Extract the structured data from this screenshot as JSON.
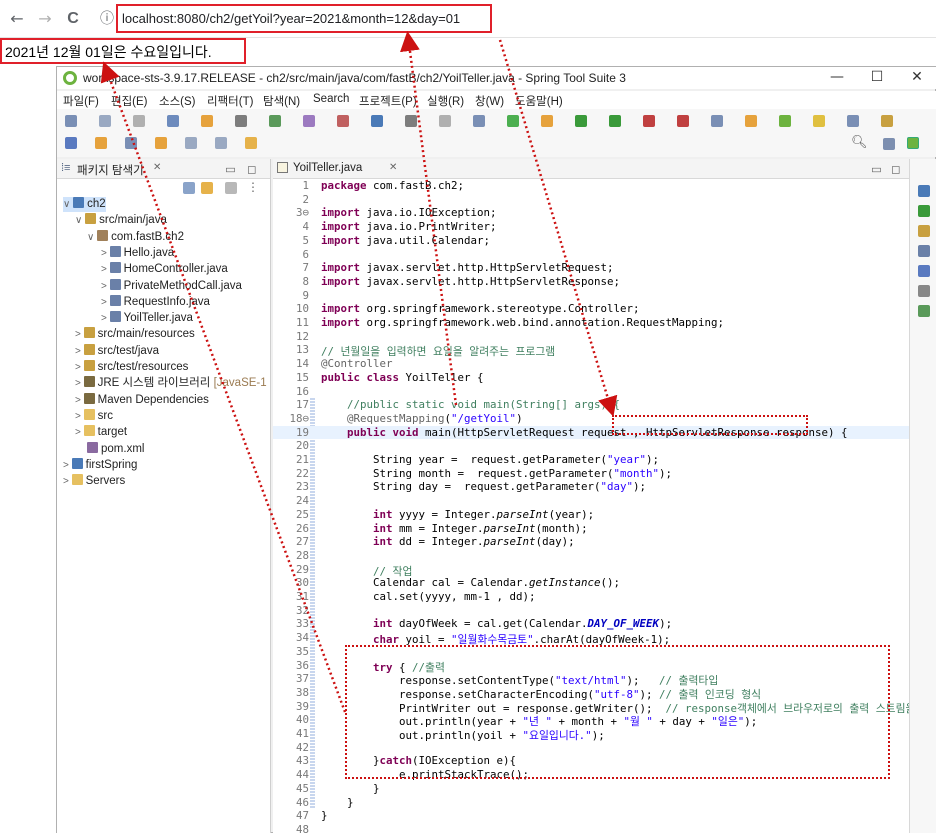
{
  "browser": {
    "back": "←",
    "forward": "→",
    "reload": "C",
    "info": "ⓘ",
    "url_host": "localhost",
    "url_rest": ":8080/ch2/getYoil?year=2021&month=12&day=01"
  },
  "page_output": "2021년 12월 01일은 수요일입니다.",
  "window": {
    "title": "workspace-sts-3.9.17.RELEASE - ch2/src/main/java/com/fastB/ch2/YoilTeller.java - Spring Tool Suite 3",
    "minimize": "—",
    "maximize": "☐",
    "close": "✕"
  },
  "menu": [
    "파일(F)",
    "편집(E)",
    "소스(S)",
    "리팩터(T)",
    "탐색(N)",
    "Search",
    "프로젝트(P)",
    "실행(R)",
    "창(W)",
    "도움말(H)"
  ],
  "explorer": {
    "title": "패키지 탐색기",
    "close": "✕",
    "items": [
      {
        "label": "ch2",
        "icon": "project-icon"
      },
      {
        "label": "src/main/java",
        "icon": "source-folder-icon"
      },
      {
        "label": "com.fastB.ch2",
        "icon": "package-icon"
      },
      {
        "label": "Hello.java",
        "icon": "java-file-icon"
      },
      {
        "label": "HomeController.java",
        "icon": "java-file-icon"
      },
      {
        "label": "PrivateMethodCall.java",
        "icon": "java-file-icon"
      },
      {
        "label": "RequestInfo.java",
        "icon": "java-file-icon"
      },
      {
        "label": "YoilTeller.java",
        "icon": "java-file-icon"
      },
      {
        "label": "src/main/resources",
        "icon": "source-folder-icon"
      },
      {
        "label": "src/test/java",
        "icon": "source-folder-icon"
      },
      {
        "label": "src/test/resources",
        "icon": "source-folder-icon"
      },
      {
        "label": "JRE 시스템 라이브러리",
        "suffix": "[JavaSE-1",
        "icon": "library-icon"
      },
      {
        "label": "Maven Dependencies",
        "icon": "library-icon"
      },
      {
        "label": "src",
        "icon": "folder-icon"
      },
      {
        "label": "target",
        "icon": "folder-icon"
      },
      {
        "label": "pom.xml",
        "icon": "xml-file-icon"
      },
      {
        "label": "firstSpring",
        "icon": "project-icon"
      },
      {
        "label": "Servers",
        "icon": "folder-icon"
      }
    ]
  },
  "editor": {
    "tab": "YoilTeller.java",
    "close": "✕",
    "lines": [
      {
        "n": "1",
        "html": "<span class='kw'>package</span> com.fastB.ch2;"
      },
      {
        "n": "2",
        "html": ""
      },
      {
        "n": "3⊖",
        "html": "<span class='kw'>import</span> java.io.IOException;"
      },
      {
        "n": "4",
        "html": "<span class='kw'>import</span> java.io.PrintWriter;"
      },
      {
        "n": "5",
        "html": "<span class='kw'>import</span> java.util.Calendar;"
      },
      {
        "n": "6",
        "html": ""
      },
      {
        "n": "7",
        "html": "<span class='kw'>import</span> javax.servlet.http.HttpServletRequest;"
      },
      {
        "n": "8",
        "html": "<span class='kw'>import</span> javax.servlet.http.HttpServletResponse;"
      },
      {
        "n": "9",
        "html": ""
      },
      {
        "n": "10",
        "html": "<span class='kw'>import</span> org.springframework.stereotype.Controller;"
      },
      {
        "n": "11",
        "html": "<span class='kw'>import</span> org.springframework.web.bind.annotation.RequestMapping;"
      },
      {
        "n": "12",
        "html": ""
      },
      {
        "n": "13",
        "html": "<span class='cm'>// 년월일을 입력하면 요일을 알려주는 프로그램</span>"
      },
      {
        "n": "14",
        "html": "<span class='an'>@Controller</span>"
      },
      {
        "n": "15",
        "html": "<span class='kw'>public class</span> YoilTeller {"
      },
      {
        "n": "16",
        "html": ""
      },
      {
        "n": "17",
        "html": "    <span class='cm'>//public static void main(String[] args) {</span>"
      },
      {
        "n": "18⊖",
        "html": "    <span class='an'>@RequestMapping</span>(<span class='str'>\"/getYoil\"</span>)"
      },
      {
        "n": "19",
        "html": "    <span class='kw'>public void</span> main(HttpServletRequest request , HttpServletResponse response) {"
      },
      {
        "n": "20",
        "html": ""
      },
      {
        "n": "21",
        "html": "        String year =  request.getParameter(<span class='str'>\"year\"</span>);"
      },
      {
        "n": "22",
        "html": "        String month =  request.getParameter(<span class='str'>\"month\"</span>);"
      },
      {
        "n": "23",
        "html": "        String day =  request.getParameter(<span class='str'>\"day\"</span>);"
      },
      {
        "n": "24",
        "html": ""
      },
      {
        "n": "25",
        "html": "        <span class='kw'>int</span> yyyy = Integer.<span class='it'>parseInt</span>(year);"
      },
      {
        "n": "26",
        "html": "        <span class='kw'>int</span> mm = Integer.<span class='it'>parseInt</span>(month);"
      },
      {
        "n": "27",
        "html": "        <span class='kw'>int</span> dd = Integer.<span class='it'>parseInt</span>(day);"
      },
      {
        "n": "28",
        "html": ""
      },
      {
        "n": "29",
        "html": "        <span class='cm'>// 작업</span>"
      },
      {
        "n": "30",
        "html": "        Calendar cal = Calendar.<span class='it'>getInstance</span>();"
      },
      {
        "n": "31",
        "html": "        cal.set(yyyy, mm-1 , dd);"
      },
      {
        "n": "32",
        "html": ""
      },
      {
        "n": "33",
        "html": "        <span class='kw'>int</span> dayOfWeek = cal.get(Calendar.<span class='st'>DAY_OF_WEEK</span>);"
      },
      {
        "n": "34",
        "html": "        <span class='kw'>char</span> yoil = <span class='str'>\"일월화수목금토\"</span>.charAt(dayOfWeek-1);"
      },
      {
        "n": "35",
        "html": ""
      },
      {
        "n": "36",
        "html": "        <span class='kw'>try</span> { <span class='cm'>//출력</span>"
      },
      {
        "n": "37",
        "html": "            response.setContentType(<span class='str'>\"text/html\"</span>);   <span class='cm'>// 출력타입</span>"
      },
      {
        "n": "38",
        "html": "            response.setCharacterEncoding(<span class='str'>\"utf-8\"</span>); <span class='cm'>// 출력 인코딩 형식</span>"
      },
      {
        "n": "39",
        "html": "            PrintWriter out = response.getWriter();  <span class='cm'>// response객체에서 브라우저로의 출력 스트림을 얻</span>"
      },
      {
        "n": "40",
        "html": "            out.println(year + <span class='str'>\"년 \"</span> + month + <span class='str'>\"월 \"</span> + day + <span class='str'>\"일은\"</span>);"
      },
      {
        "n": "41",
        "html": "            out.println(yoil + <span class='str'>\"요일입니다.\"</span>);"
      },
      {
        "n": "42",
        "html": ""
      },
      {
        "n": "43",
        "html": "        }<span class='kw'>catch</span>(IOException e){"
      },
      {
        "n": "44",
        "html": "            e.printStackTrace();"
      },
      {
        "n": "45",
        "html": "        }"
      },
      {
        "n": "46",
        "html": "    }"
      },
      {
        "n": "47",
        "html": "}"
      },
      {
        "n": "48",
        "html": ""
      }
    ]
  },
  "colors": {
    "highlight_red": "#e0202a",
    "arrow_red": "#cc1111"
  }
}
